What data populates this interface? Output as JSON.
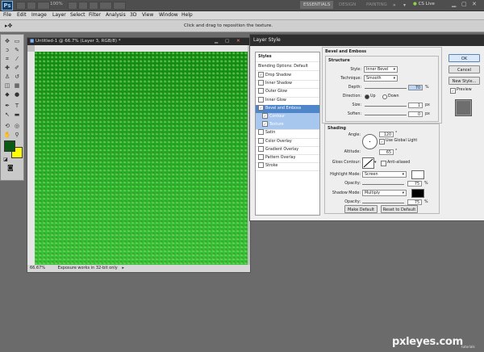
{
  "app": {
    "logo": "Ps",
    "zoom": "100%",
    "workspaces": [
      "ESSENTIALS",
      "DESIGN",
      "PAINTING"
    ],
    "search": "CS Live"
  },
  "menubar": [
    "File",
    "Edit",
    "Image",
    "Layer",
    "Select",
    "Filter",
    "Analysis",
    "3D",
    "View",
    "Window",
    "Help"
  ],
  "optionsbar": {
    "hint": "Click and drag to reposition the texture."
  },
  "document": {
    "title": "Untitled-1 @ 66.7% (Layer 3, RGB/8) *",
    "zoom": "66.67%",
    "status": "Exposure works in 32-bit only",
    "colors": {
      "foreground": "#0a5a15",
      "background": "#ffff00"
    }
  },
  "dialog": {
    "title": "Layer Style",
    "styles_header": "Styles",
    "blending": "Blending Options: Default",
    "items": [
      {
        "label": "Drop Shadow",
        "checked": true,
        "state": ""
      },
      {
        "label": "Inner Shadow",
        "checked": false,
        "state": ""
      },
      {
        "label": "Outer Glow",
        "checked": false,
        "state": ""
      },
      {
        "label": "Inner Glow",
        "checked": false,
        "state": ""
      },
      {
        "label": "Bevel and Emboss",
        "checked": true,
        "state": "sel"
      },
      {
        "label": "Contour",
        "checked": true,
        "state": "sub"
      },
      {
        "label": "Texture",
        "checked": true,
        "state": "sub"
      },
      {
        "label": "Satin",
        "checked": false,
        "state": ""
      },
      {
        "label": "Color Overlay",
        "checked": false,
        "state": ""
      },
      {
        "label": "Gradient Overlay",
        "checked": false,
        "state": ""
      },
      {
        "label": "Pattern Overlay",
        "checked": false,
        "state": ""
      },
      {
        "label": "Stroke",
        "checked": false,
        "state": ""
      }
    ],
    "bevel": {
      "section": "Bevel and Emboss",
      "structure": "Structure",
      "style_label": "Style:",
      "style_value": "Inner Bevel",
      "technique_label": "Technique:",
      "technique_value": "Smooth",
      "depth_label": "Depth:",
      "depth_value": "70",
      "depth_unit": "%",
      "direction_label": "Direction:",
      "dir_up": "Up",
      "dir_down": "Down",
      "size_label": "Size:",
      "size_value": "1",
      "size_unit": "px",
      "soften_label": "Soften:",
      "soften_value": "0",
      "soften_unit": "px",
      "shading": "Shading",
      "angle_label": "Angle:",
      "angle_value": "120",
      "global_light": "Use Global Light",
      "altitude_label": "Altitude:",
      "altitude_value": "65",
      "gloss_label": "Gloss Contour:",
      "antialiased": "Anti-aliased",
      "highlight_label": "Highlight Mode:",
      "highlight_value": "Screen",
      "highlight_color": "#ffffff",
      "hl_opacity_label": "Opacity:",
      "hl_opacity_value": "75",
      "hl_opacity_unit": "%",
      "shadow_label": "Shadow Mode:",
      "shadow_value": "Multiply",
      "shadow_color": "#000000",
      "sh_opacity_label": "Opacity:",
      "sh_opacity_value": "75",
      "sh_opacity_unit": "%",
      "make_default": "Make Default",
      "reset_default": "Reset to Default"
    },
    "buttons": {
      "ok": "OK",
      "cancel": "Cancel",
      "new_style": "New Style...",
      "preview": "Preview"
    }
  },
  "watermark": {
    "main": "pxleyes.com",
    "sub": "tutorials"
  }
}
